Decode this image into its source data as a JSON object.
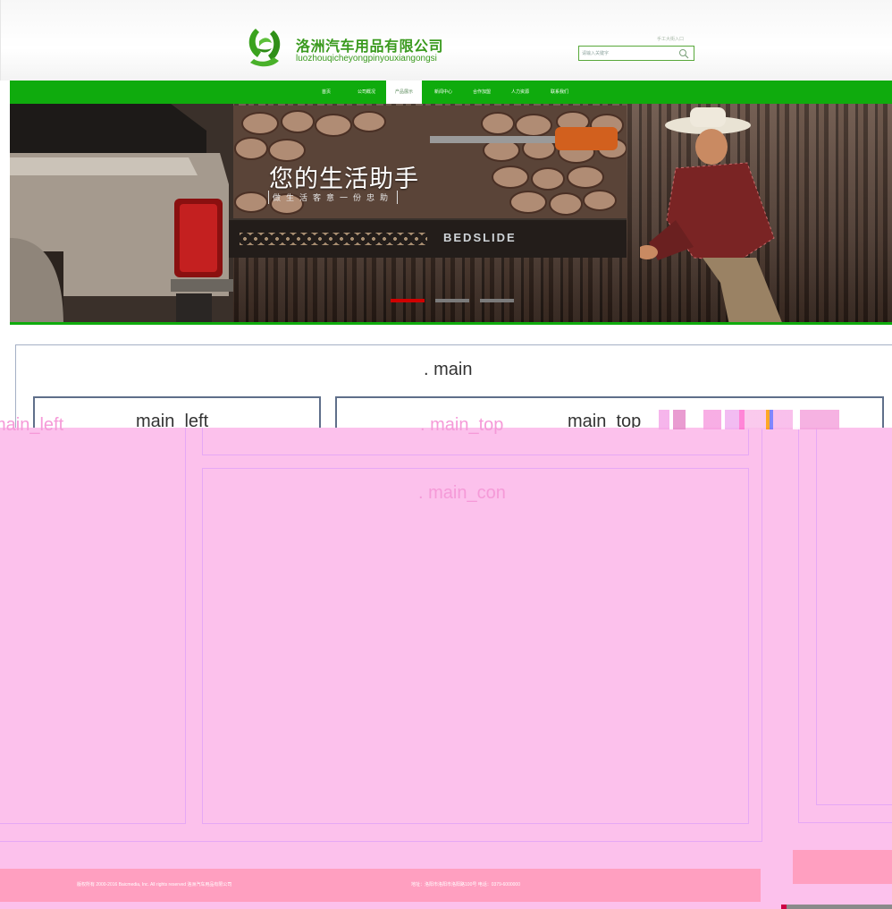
{
  "header": {
    "company_name_cn": "洛洲汽车用品有限公司",
    "company_name_pinyin": "luozhouqicheyongpinyouxiangongsi",
    "top_link": "手工大街入口",
    "search": {
      "placeholder": "请输入关键字"
    }
  },
  "nav": {
    "items": [
      {
        "label": "首页"
      },
      {
        "label": "公司概况"
      },
      {
        "label": "产品展示",
        "active": true
      },
      {
        "label": "新闻中心"
      },
      {
        "label": "合作加盟"
      },
      {
        "label": "人力资源"
      },
      {
        "label": "联系我们"
      }
    ]
  },
  "banner": {
    "title": "您的生活助手",
    "subtitle": "做生活客意一份忠助",
    "product_label": "BEDSLIDE",
    "slides_total": 3,
    "active_slide": 1
  },
  "layout_labels": {
    "main": ". main",
    "main_left": "main_left",
    "main_top": "main_top",
    "pink_left": "main_left",
    "pink_top": ". main_top",
    "pink_con": ". main_con"
  },
  "footer": {
    "copyright": "版权所有 2000-2016 Baicmedia, Inc. All rights reserved 洛洲汽车用品有限公司",
    "address": "地址：洛阳市洛阳市洛阳路100号 电话：0379-6000000"
  },
  "colors": {
    "brand_green": "#0fab0d",
    "logo_green": "#3a9a1e",
    "debug_pink": "#fcc1ec",
    "footer_pink": "#ff9fc0",
    "slider_active": "#d00000"
  }
}
